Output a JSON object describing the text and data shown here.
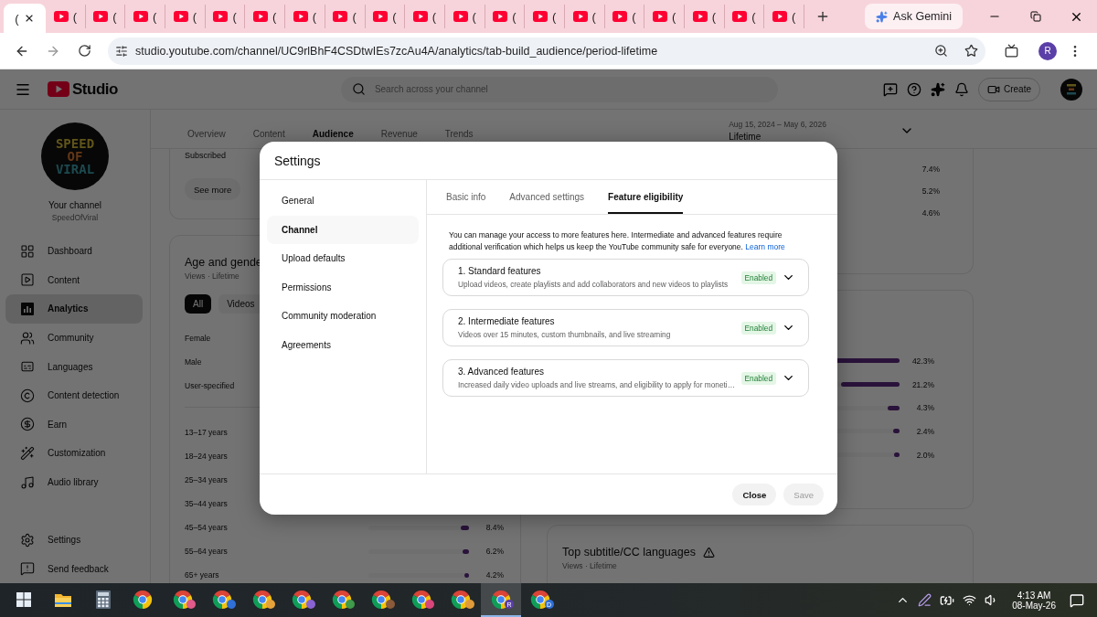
{
  "browser": {
    "tabs": [
      {
        "label": "(",
        "selected": true
      },
      {
        "label": "(",
        "selected": false
      },
      {
        "label": "(",
        "selected": false
      },
      {
        "label": "(",
        "selected": false
      },
      {
        "label": "(",
        "selected": false
      },
      {
        "label": "(",
        "selected": false
      },
      {
        "label": "(",
        "selected": false
      },
      {
        "label": "(",
        "selected": false
      },
      {
        "label": "(",
        "selected": false
      },
      {
        "label": "(",
        "selected": false
      },
      {
        "label": "(",
        "selected": false
      },
      {
        "label": "(",
        "selected": false
      },
      {
        "label": "(",
        "selected": false
      },
      {
        "label": "(",
        "selected": false
      },
      {
        "label": "(",
        "selected": false
      },
      {
        "label": "(",
        "selected": false
      },
      {
        "label": "(",
        "selected": false
      },
      {
        "label": "(",
        "selected": false
      },
      {
        "label": "(",
        "selected": false
      },
      {
        "label": "(",
        "selected": false
      }
    ],
    "gemini": "Ask Gemini",
    "url": "studio.youtube.com/channel/UC9rlBhF4CSDtwIEs7zcAu4A/analytics/tab-build_audience/period-lifetime",
    "profile": "R"
  },
  "header": {
    "logo": "Studio",
    "search": {
      "placeholder": "Search across your channel"
    },
    "create": "Create"
  },
  "channel": {
    "logo_lines": [
      "SPEED",
      "OF",
      "VIRAL"
    ],
    "label": "Your channel",
    "handle": "SpeedOfViral"
  },
  "sidebar": {
    "items": [
      {
        "kind": "dashboard",
        "label": "Dashboard",
        "selected": false
      },
      {
        "kind": "content",
        "label": "Content",
        "selected": false
      },
      {
        "kind": "analytics",
        "label": "Analytics",
        "selected": true
      },
      {
        "kind": "community",
        "label": "Community",
        "selected": false
      },
      {
        "kind": "languages",
        "label": "Languages",
        "selected": false
      },
      {
        "kind": "detection",
        "label": "Content detection",
        "selected": false
      },
      {
        "kind": "earn",
        "label": "Earn",
        "selected": false
      },
      {
        "kind": "customization",
        "label": "Customization",
        "selected": false
      },
      {
        "kind": "audio",
        "label": "Audio library",
        "selected": false
      }
    ],
    "footer": [
      {
        "kind": "settings",
        "label": "Settings"
      },
      {
        "kind": "feedback",
        "label": "Send feedback"
      }
    ]
  },
  "analytics": {
    "tabs": [
      {
        "label": "Overview",
        "selected": false
      },
      {
        "label": "Content",
        "selected": false
      },
      {
        "label": "Audience",
        "selected": true
      },
      {
        "label": "Revenue",
        "selected": false
      },
      {
        "label": "Trends",
        "selected": false
      }
    ],
    "date_range": {
      "dates": "Aug 15, 2024 – May 6, 2026",
      "period": "Lifetime"
    },
    "subscribed_card": {
      "row": "Subscribed",
      "button": "See more"
    },
    "age_gender": {
      "title": "Age and gende",
      "subtitle": "Views · Lifetime",
      "chips": [
        {
          "label": "All",
          "selected": true
        },
        {
          "label": "Videos",
          "selected": false
        }
      ],
      "gender_rows": [
        "Female",
        "Male",
        "User-specified"
      ],
      "age_rows": [
        {
          "label": "13–17 years"
        },
        {
          "label": "18–24 years"
        },
        {
          "label": "25–34 years"
        },
        {
          "label": "35–44 years"
        },
        {
          "label": "45–54 years",
          "value": "8.4%",
          "level": 0.084
        },
        {
          "label": "55–64 years",
          "value": "6.2%",
          "level": 0.062
        },
        {
          "label": "65+ years",
          "value": "4.2%",
          "level": 0.042
        }
      ]
    },
    "right_card_values": [
      "7.4%",
      "5.2%",
      "4.6%"
    ],
    "right_card_bars": [
      {
        "value": "42.3%",
        "level": 0.423
      },
      {
        "value": "21.2%",
        "level": 0.212
      },
      {
        "value": "4.3%",
        "level": 0.043
      },
      {
        "value": "2.4%",
        "level": 0.024
      },
      {
        "value": "2.0%",
        "level": 0.02
      }
    ],
    "subtitles_card": {
      "title": "Top subtitle/CC languages",
      "subtitle": "Views · Lifetime"
    }
  },
  "settings_dialog": {
    "title": "Settings",
    "nav": [
      {
        "label": "General",
        "selected": false
      },
      {
        "label": "Channel",
        "selected": true
      },
      {
        "label": "Upload defaults",
        "selected": false
      },
      {
        "label": "Permissions",
        "selected": false
      },
      {
        "label": "Community moderation",
        "selected": false
      },
      {
        "label": "Agreements",
        "selected": false
      }
    ],
    "tabs": [
      {
        "label": "Basic info",
        "selected": false
      },
      {
        "label": "Advanced settings",
        "selected": false
      },
      {
        "label": "Feature eligibility",
        "selected": true
      }
    ],
    "intro": "You can manage your access to more features here. Intermediate and advanced features require additional verification which helps us keep the YouTube community safe for everyone.",
    "intro_link": "Learn more",
    "features": [
      {
        "title": "1. Standard features",
        "description": "Upload videos, create playlists and add collaborators and new videos to playlists",
        "status": "Enabled"
      },
      {
        "title": "2. Intermediate features",
        "description": "Videos over 15 minutes, custom thumbnails, and live streaming",
        "status": "Enabled"
      },
      {
        "title": "3. Advanced features",
        "description": "Increased daily video uploads and live streams, and eligibility to apply for moneti…",
        "status": "Enabled"
      }
    ],
    "buttons": [
      {
        "label": "Close",
        "disabled": false
      },
      {
        "label": "Save",
        "disabled": true
      }
    ]
  },
  "taskbar": {
    "apps": [
      {
        "kind": "start",
        "selected": false
      },
      {
        "kind": "explorer",
        "selected": false
      },
      {
        "kind": "calculator",
        "selected": false
      },
      {
        "kind": "chrome",
        "selected": false
      },
      {
        "kind": "chrome",
        "selected": false,
        "color": "#e05a8a"
      },
      {
        "kind": "chrome",
        "selected": false,
        "color": "#2f6fd6"
      },
      {
        "kind": "chrome",
        "selected": false,
        "color": "#e6a23a"
      },
      {
        "kind": "chrome",
        "selected": false,
        "color": "#8a63d2"
      },
      {
        "kind": "chrome",
        "selected": false,
        "color": "#3f9a4a"
      },
      {
        "kind": "chrome",
        "selected": false,
        "color": "#8a5a3a"
      },
      {
        "kind": "chrome",
        "selected": false,
        "color": "#d8467a"
      },
      {
        "kind": "chrome",
        "selected": false,
        "color": "#e09a3a"
      },
      {
        "kind": "chrome",
        "selected": true,
        "color": "#5b3fa8",
        "badge": "R"
      },
      {
        "kind": "chrome",
        "selected": false,
        "color": "#2f6fd6",
        "badge": "D"
      }
    ],
    "time": "4:13 AM",
    "date": "08-May-26"
  }
}
